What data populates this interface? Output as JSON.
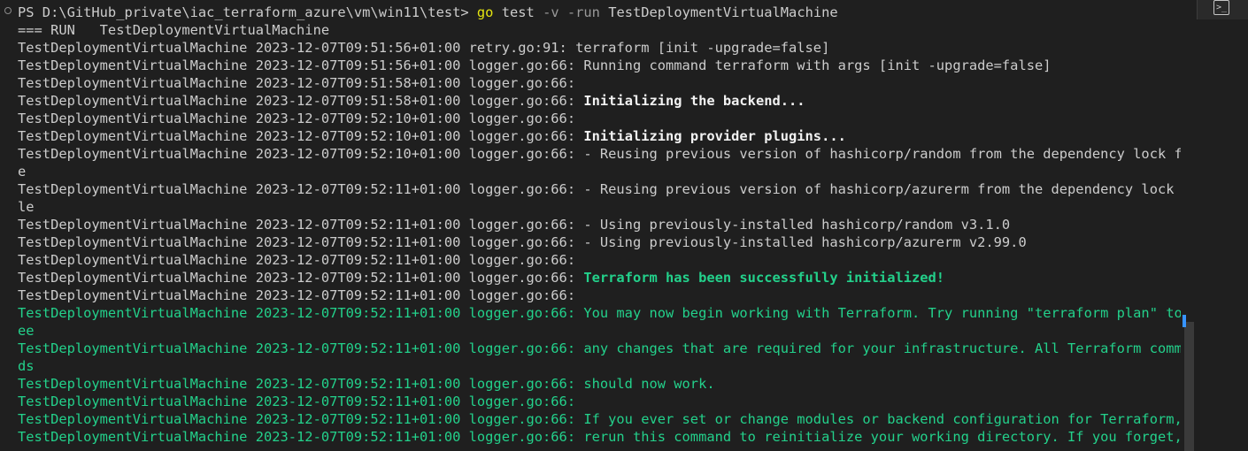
{
  "prompt": {
    "path": "PS D:\\GitHub_private\\iac_terraform_azure\\vm\\win11\\test> ",
    "cmd_go": "go",
    "cmd_test": " test ",
    "cmd_flags": "-v -run",
    "cmd_name": " TestDeploymentVirtualMachine"
  },
  "terminal_tab_icon": ">_",
  "colors": {
    "background": "#1f1f1f",
    "text": "#cccccc",
    "green": "#23d18b",
    "yellow": "#e5e510",
    "scroll_marker": "#3794ff"
  },
  "lines": [
    {
      "text": "=== RUN   TestDeploymentVirtualMachine"
    },
    {
      "text": "TestDeploymentVirtualMachine 2023-12-07T09:51:56+01:00 retry.go:91: terraform [init -upgrade=false]"
    },
    {
      "text": "TestDeploymentVirtualMachine 2023-12-07T09:51:56+01:00 logger.go:66: Running command terraform with args [init -upgrade=false]"
    },
    {
      "text": "TestDeploymentVirtualMachine 2023-12-07T09:51:58+01:00 logger.go:66: "
    },
    {
      "prefix": "TestDeploymentVirtualMachine 2023-12-07T09:51:58+01:00 logger.go:66: ",
      "bold": "Initializing the backend..."
    },
    {
      "text": "TestDeploymentVirtualMachine 2023-12-07T09:52:10+01:00 logger.go:66: "
    },
    {
      "prefix": "TestDeploymentVirtualMachine 2023-12-07T09:52:10+01:00 logger.go:66: ",
      "bold": "Initializing provider plugins..."
    },
    {
      "text": "TestDeploymentVirtualMachine 2023-12-07T09:52:10+01:00 logger.go:66: - Reusing previous version of hashicorp/random from the dependency lock fil"
    },
    {
      "text": "e"
    },
    {
      "text": "TestDeploymentVirtualMachine 2023-12-07T09:52:11+01:00 logger.go:66: - Reusing previous version of hashicorp/azurerm from the dependency lock fi"
    },
    {
      "text": "le"
    },
    {
      "text": "TestDeploymentVirtualMachine 2023-12-07T09:52:11+01:00 logger.go:66: - Using previously-installed hashicorp/random v3.1.0"
    },
    {
      "text": "TestDeploymentVirtualMachine 2023-12-07T09:52:11+01:00 logger.go:66: - Using previously-installed hashicorp/azurerm v2.99.0"
    },
    {
      "text": "TestDeploymentVirtualMachine 2023-12-07T09:52:11+01:00 logger.go:66: "
    },
    {
      "prefix": "TestDeploymentVirtualMachine 2023-12-07T09:52:11+01:00 logger.go:66: ",
      "boldgreen": "Terraform has been successfully initialized!"
    },
    {
      "text": "TestDeploymentVirtualMachine 2023-12-07T09:52:11+01:00 logger.go:66: "
    },
    {
      "green": "TestDeploymentVirtualMachine 2023-12-07T09:52:11+01:00 logger.go:66: You may now begin working with Terraform. Try running \"terraform plan\" to s"
    },
    {
      "green": "ee"
    },
    {
      "green": "TestDeploymentVirtualMachine 2023-12-07T09:52:11+01:00 logger.go:66: any changes that are required for your infrastructure. All Terraform comman"
    },
    {
      "green": "ds"
    },
    {
      "green": "TestDeploymentVirtualMachine 2023-12-07T09:52:11+01:00 logger.go:66: should now work."
    },
    {
      "green": "TestDeploymentVirtualMachine 2023-12-07T09:52:11+01:00 logger.go:66: "
    },
    {
      "green": "TestDeploymentVirtualMachine 2023-12-07T09:52:11+01:00 logger.go:66: If you ever set or change modules or backend configuration for Terraform,"
    },
    {
      "green": "TestDeploymentVirtualMachine 2023-12-07T09:52:11+01:00 logger.go:66: rerun this command to reinitialize your working directory. If you forget, o"
    }
  ]
}
